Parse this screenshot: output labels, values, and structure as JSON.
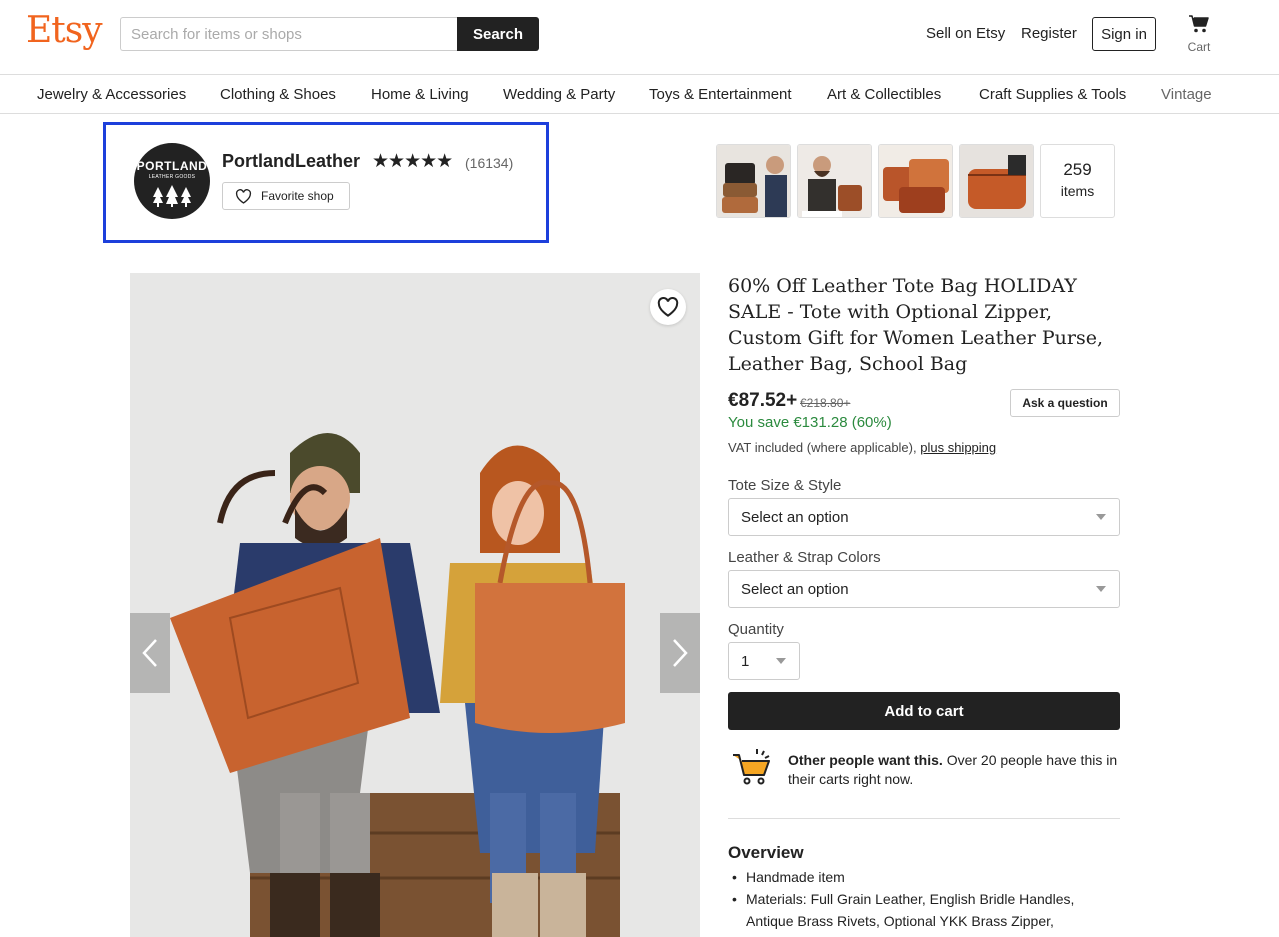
{
  "header": {
    "logo": "Etsy",
    "search_placeholder": "Search for items or shops",
    "search_button": "Search",
    "sell": "Sell on Etsy",
    "register": "Register",
    "sign_in": "Sign in",
    "cart": "Cart"
  },
  "categories": [
    "Jewelry & Accessories",
    "Clothing & Shoes",
    "Home & Living",
    "Wedding & Party",
    "Toys & Entertainment",
    "Art & Collectibles",
    "Craft Supplies & Tools",
    "Vintage"
  ],
  "shop": {
    "logo_line1": "PORTLAND",
    "logo_line2": "LEATHER GOODS",
    "name": "PortlandLeather",
    "rating_stars": "★★★★★",
    "rating": 5,
    "review_count": "(16134)",
    "favorite_label": "Favorite shop",
    "items_count": "259",
    "items_label": "items"
  },
  "listing": {
    "title": "60% Off Leather Tote Bag HOLIDAY SALE - Tote with Optional Zipper, Custom Gift for Women Leather Purse, Leather Bag, School Bag",
    "price": "€87.52+",
    "original_price": "€218.80+",
    "savings": "You save €131.28 (60%)",
    "vat_text": "VAT included (where applicable),",
    "shipping_link": "plus shipping",
    "ask_button": "Ask a question",
    "option1_label": "Tote Size & Style",
    "option1_value": "Select an option",
    "option2_label": "Leather & Strap Colors",
    "option2_value": "Select an option",
    "quantity_label": "Quantity",
    "quantity_value": "1",
    "add_to_cart": "Add to cart",
    "demand_bold": "Other people want this.",
    "demand_text": "Over 20 people have this in their carts right now.",
    "overview_heading": "Overview",
    "overview_items": [
      "Handmade item",
      "Materials: Full Grain Leather, English Bridle Handles, Antique Brass Rivets, Optional YKK Brass Zipper,"
    ]
  },
  "colors": {
    "brand": "#f1641e",
    "highlight_box": "#1d3fdb",
    "savings_green": "#2b8a3e",
    "dark_button": "#222222"
  }
}
